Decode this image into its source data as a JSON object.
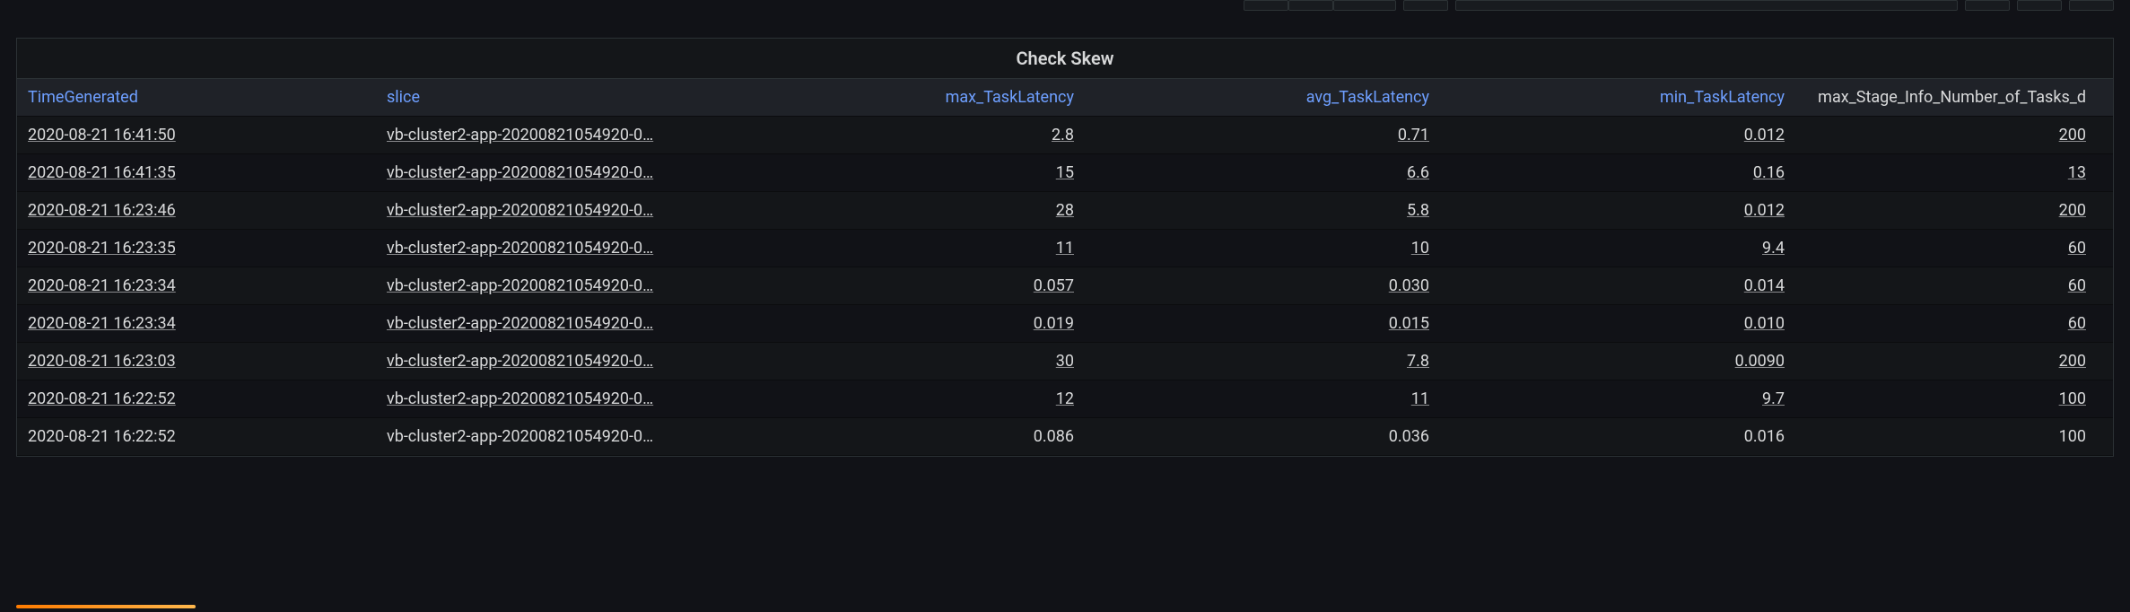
{
  "panel": {
    "title": "Check Skew"
  },
  "columns": [
    {
      "label": "TimeGenerated",
      "link": true,
      "align": "left"
    },
    {
      "label": "slice",
      "link": true,
      "align": "left"
    },
    {
      "label": "max_TaskLatency",
      "link": true,
      "align": "right"
    },
    {
      "label": "avg_TaskLatency",
      "link": true,
      "align": "right"
    },
    {
      "label": "min_TaskLatency",
      "link": true,
      "align": "right"
    },
    {
      "label": "max_Stage_Info_Number_of_Tasks_d",
      "link": false,
      "align": "right"
    }
  ],
  "rows": [
    {
      "link": true,
      "TimeGenerated": "2020-08-21 16:41:50",
      "slice": "vb-cluster2-app-20200821054920-0…",
      "max_TaskLatency": "2.8",
      "avg_TaskLatency": "0.71",
      "min_TaskLatency": "0.012",
      "max_Stage_Info_Number_of_Tasks_d": "200"
    },
    {
      "link": true,
      "TimeGenerated": "2020-08-21 16:41:35",
      "slice": "vb-cluster2-app-20200821054920-0…",
      "max_TaskLatency": "15",
      "avg_TaskLatency": "6.6",
      "min_TaskLatency": "0.16",
      "max_Stage_Info_Number_of_Tasks_d": "13"
    },
    {
      "link": true,
      "TimeGenerated": "2020-08-21 16:23:46",
      "slice": "vb-cluster2-app-20200821054920-0…",
      "max_TaskLatency": "28",
      "avg_TaskLatency": "5.8",
      "min_TaskLatency": "0.012",
      "max_Stage_Info_Number_of_Tasks_d": "200"
    },
    {
      "link": true,
      "TimeGenerated": "2020-08-21 16:23:35",
      "slice": "vb-cluster2-app-20200821054920-0…",
      "max_TaskLatency": "11",
      "avg_TaskLatency": "10",
      "min_TaskLatency": "9.4",
      "max_Stage_Info_Number_of_Tasks_d": "60"
    },
    {
      "link": true,
      "TimeGenerated": "2020-08-21 16:23:34",
      "slice": "vb-cluster2-app-20200821054920-0…",
      "max_TaskLatency": "0.057",
      "avg_TaskLatency": "0.030",
      "min_TaskLatency": "0.014",
      "max_Stage_Info_Number_of_Tasks_d": "60"
    },
    {
      "link": true,
      "TimeGenerated": "2020-08-21 16:23:34",
      "slice": "vb-cluster2-app-20200821054920-0…",
      "max_TaskLatency": "0.019",
      "avg_TaskLatency": "0.015",
      "min_TaskLatency": "0.010",
      "max_Stage_Info_Number_of_Tasks_d": "60"
    },
    {
      "link": true,
      "TimeGenerated": "2020-08-21 16:23:03",
      "slice": "vb-cluster2-app-20200821054920-0…",
      "max_TaskLatency": "30",
      "avg_TaskLatency": "7.8",
      "min_TaskLatency": "0.0090",
      "max_Stage_Info_Number_of_Tasks_d": "200"
    },
    {
      "link": true,
      "TimeGenerated": "2020-08-21 16:22:52",
      "slice": "vb-cluster2-app-20200821054920-0…",
      "max_TaskLatency": "12",
      "avg_TaskLatency": "11",
      "min_TaskLatency": "9.7",
      "max_Stage_Info_Number_of_Tasks_d": "100"
    },
    {
      "link": false,
      "TimeGenerated": "2020-08-21 16:22:52",
      "slice": "vb-cluster2-app-20200821054920-0…",
      "max_TaskLatency": "0.086",
      "avg_TaskLatency": "0.036",
      "min_TaskLatency": "0.016",
      "max_Stage_Info_Number_of_Tasks_d": "100"
    }
  ]
}
